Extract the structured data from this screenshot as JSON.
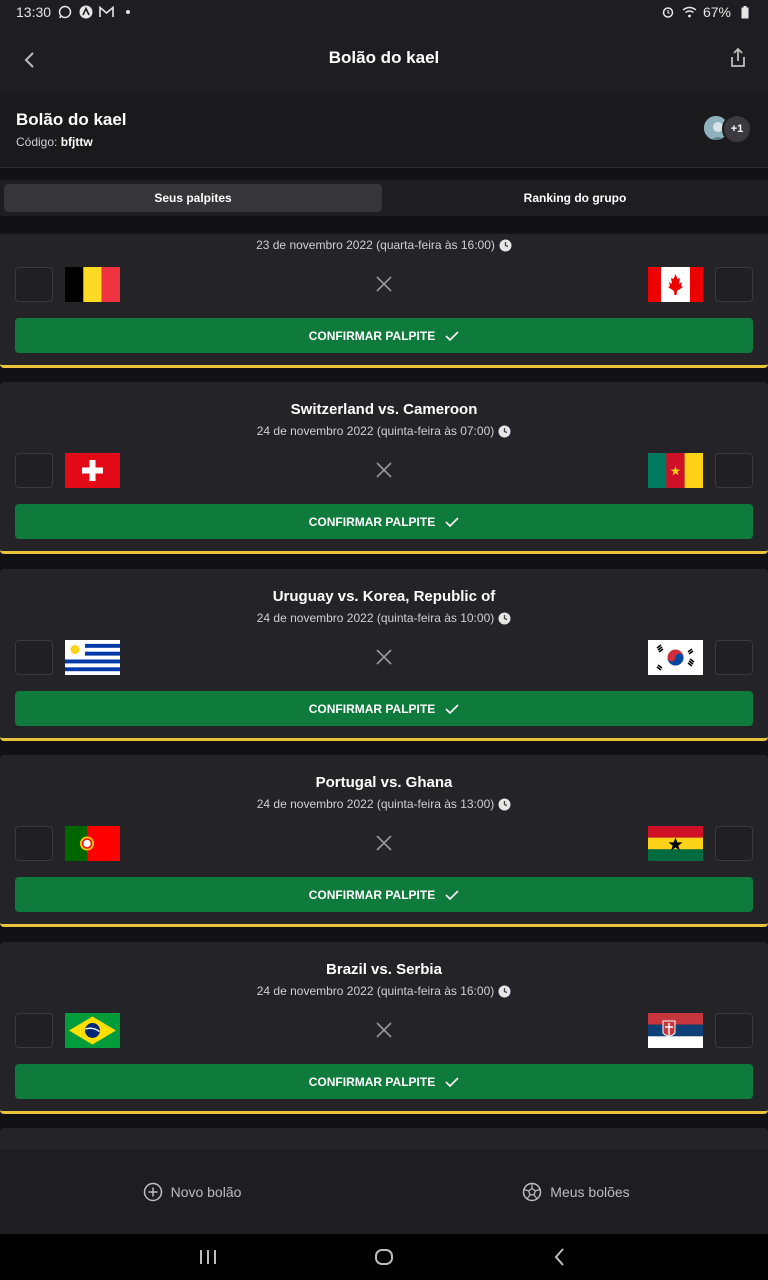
{
  "status_bar": {
    "time": "13:30",
    "battery": "67%"
  },
  "app_bar": {
    "title": "Bolão do kael"
  },
  "group": {
    "name": "Bolão do kael",
    "code_label": "Código:",
    "code": "bfjttw",
    "more_members": "+1"
  },
  "tabs": [
    {
      "label": "Seus palpites",
      "active": true
    },
    {
      "label": "Ranking do grupo",
      "active": false
    }
  ],
  "matches": [
    {
      "title": "",
      "date": "23 de novembro 2022 (quarta-feira às 16:00)",
      "home_flag": "belgium-flag",
      "away_flag": "canada-flag",
      "confirm_label": "CONFIRMAR PALPITE"
    },
    {
      "title": "Switzerland vs. Cameroon",
      "date": "24 de novembro 2022 (quinta-feira às 07:00)",
      "home_flag": "switzerland-flag",
      "away_flag": "cameroon-flag",
      "confirm_label": "CONFIRMAR PALPITE"
    },
    {
      "title": "Uruguay vs. Korea, Republic of",
      "date": "24 de novembro 2022 (quinta-feira às 10:00)",
      "home_flag": "uruguay-flag",
      "away_flag": "korea-flag",
      "confirm_label": "CONFIRMAR PALPITE"
    },
    {
      "title": "Portugal vs. Ghana",
      "date": "24 de novembro 2022 (quinta-feira às 13:00)",
      "home_flag": "portugal-flag",
      "away_flag": "ghana-flag",
      "confirm_label": "CONFIRMAR PALPITE"
    },
    {
      "title": "Brazil vs. Serbia",
      "date": "24 de novembro 2022 (quinta-feira às 16:00)",
      "home_flag": "brazil-flag",
      "away_flag": "serbia-flag",
      "confirm_label": "CONFIRMAR PALPITE"
    }
  ],
  "bottom_nav": [
    {
      "label": "Novo bolão",
      "icon": "plus-circle-icon"
    },
    {
      "label": "Meus bolões",
      "icon": "soccer-ball-icon"
    }
  ],
  "colors": {
    "confirm_green": "#0e7a3b",
    "card_border_gold": "#e9c43a",
    "background": "#121215"
  }
}
